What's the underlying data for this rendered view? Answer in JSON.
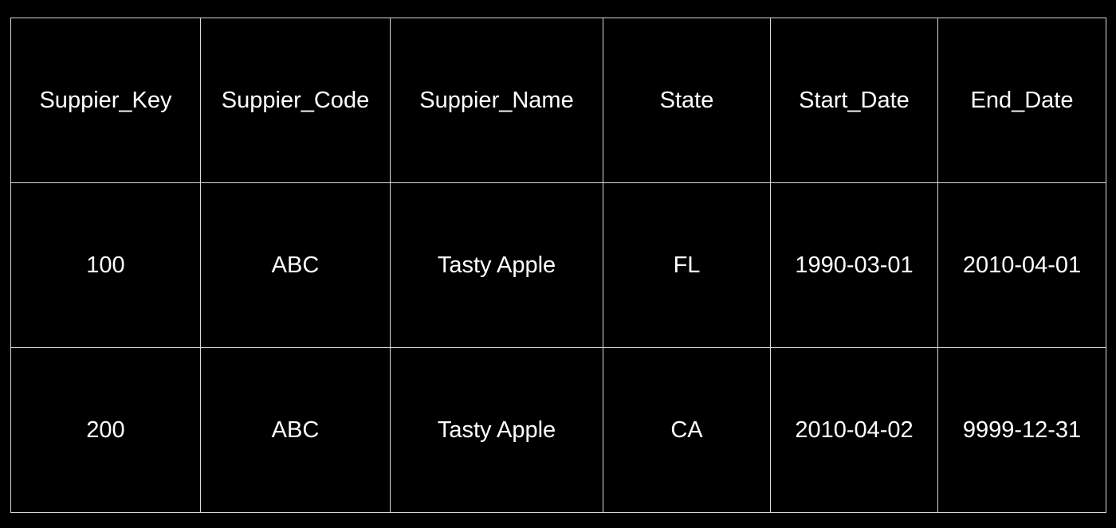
{
  "table": {
    "headers": [
      "Suppier_Key",
      "Suppier_Code",
      "Suppier_Name",
      "State",
      "Start_Date",
      "End_Date"
    ],
    "rows": [
      [
        "100",
        "ABC",
        "Tasty Apple",
        "FL",
        "1990-03-01",
        "2010-04-01"
      ],
      [
        "200",
        "ABC",
        "Tasty Apple",
        "CA",
        "2010-04-02",
        "9999-12-31"
      ]
    ]
  },
  "colors": {
    "background": "#000000",
    "text": "#ffffff",
    "border": "#d9d9d9"
  }
}
